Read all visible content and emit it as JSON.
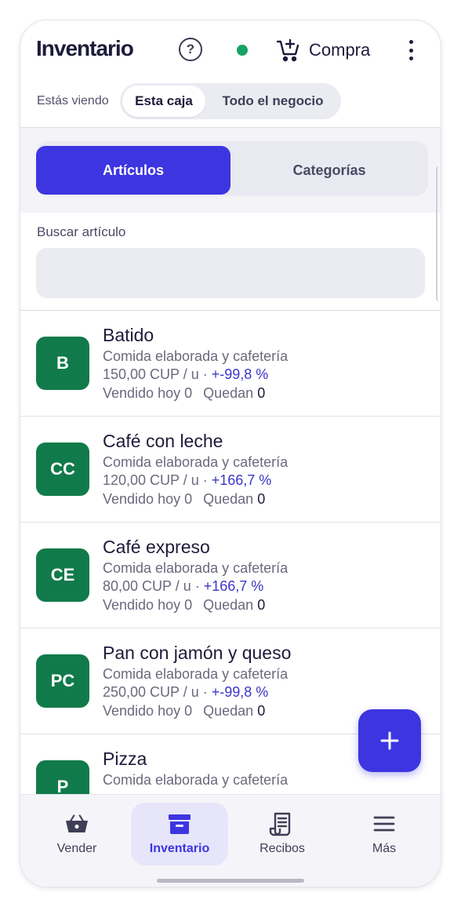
{
  "header": {
    "title": "Inventario",
    "help_icon": "help-circle-icon",
    "status_color": "#15a366",
    "purchase_label": "Compra",
    "purchase_icon": "cart-plus-icon",
    "more_icon": "more-vertical-icon"
  },
  "view_toggle": {
    "label": "Estás viendo",
    "options": [
      "Esta caja",
      "Todo el negocio"
    ],
    "selected": "Esta caja"
  },
  "tabs": {
    "items": [
      "Artículos",
      "Categorías"
    ],
    "selected": "Artículos"
  },
  "search": {
    "label": "Buscar artículo",
    "value": "",
    "placeholder": ""
  },
  "items": [
    {
      "initials": "B",
      "name": "Batido",
      "category": "Comida elaborada y cafetería",
      "price": "150,00 CUP / u",
      "separator": " · ",
      "margin": "+-99,8 %",
      "sold_label": "Vendido hoy",
      "sold": "0",
      "left_label": "Quedan",
      "left": "0"
    },
    {
      "initials": "CC",
      "name": "Café con leche",
      "category": "Comida elaborada y cafetería",
      "price": "120,00 CUP / u",
      "separator": " · ",
      "margin": "+166,7 %",
      "sold_label": "Vendido hoy",
      "sold": "0",
      "left_label": "Quedan",
      "left": "0"
    },
    {
      "initials": "CE",
      "name": "Café expreso",
      "category": "Comida elaborada y cafetería",
      "price": "80,00 CUP / u",
      "separator": " · ",
      "margin": "+166,7 %",
      "sold_label": "Vendido hoy",
      "sold": "0",
      "left_label": "Quedan",
      "left": "0"
    },
    {
      "initials": "PC",
      "name": "Pan con jamón y queso",
      "category": "Comida elaborada y cafetería",
      "price": "250,00 CUP / u",
      "separator": " · ",
      "margin": "+-99,8 %",
      "sold_label": "Vendido hoy",
      "sold": "0",
      "left_label": "Quedan",
      "left": "0"
    },
    {
      "initials": "P",
      "name": "Pizza",
      "category": "Comida elaborada y cafetería"
    }
  ],
  "fab": {
    "icon": "plus-icon"
  },
  "bottom_nav": {
    "items": [
      {
        "label": "Vender",
        "icon": "basket-icon"
      },
      {
        "label": "Inventario",
        "icon": "archive-box-icon"
      },
      {
        "label": "Recibos",
        "icon": "receipt-icon"
      },
      {
        "label": "Más",
        "icon": "hamburger-menu-icon"
      }
    ],
    "selected": "Inventario"
  },
  "colors": {
    "accent": "#3d35e0",
    "avatar_bg": "#117a4b",
    "margin_text": "#3d35c8"
  }
}
